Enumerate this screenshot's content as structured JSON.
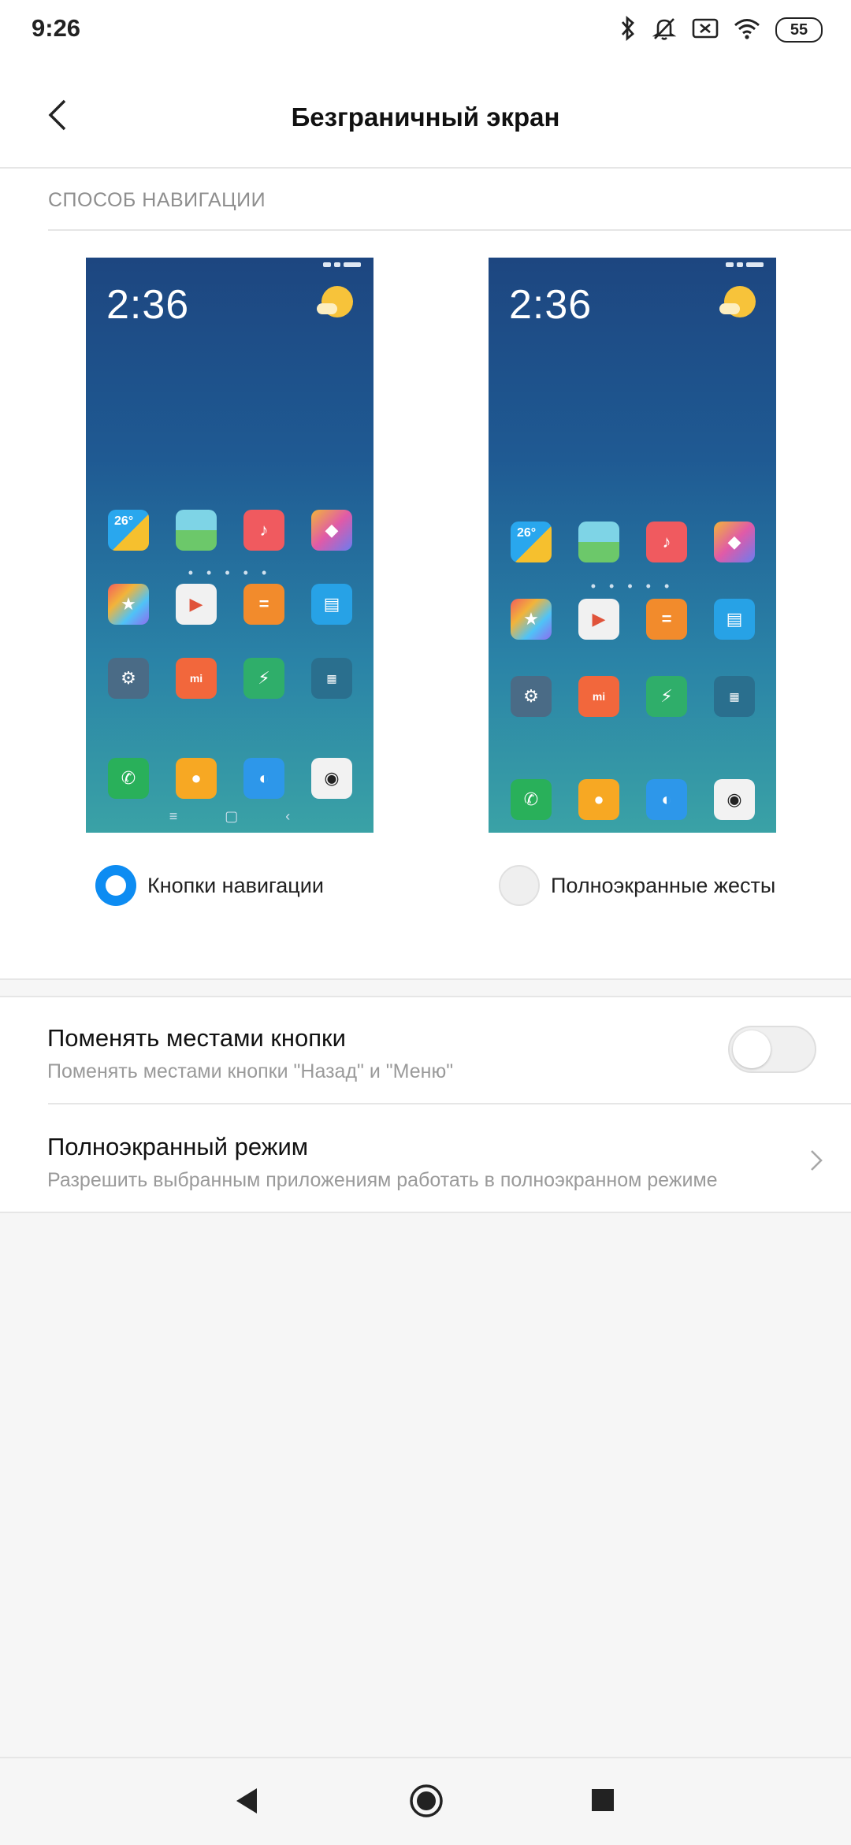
{
  "status_bar": {
    "time": "9:26",
    "battery": "55"
  },
  "header": {
    "title": "Безграничный экран"
  },
  "section": {
    "label": "СПОСОБ НАВИГАЦИИ"
  },
  "preview": {
    "clock": "2:36",
    "weather_tile": "26°",
    "store_tile": "mi"
  },
  "options": [
    {
      "label": "Кнопки навигации",
      "selected": true
    },
    {
      "label": "Полноэкранные жесты",
      "selected": false
    }
  ],
  "settings": {
    "swap": {
      "title": "Поменять местами кнопки",
      "subtitle": "Поменять местами кнопки \"Назад\" и \"Меню\"",
      "enabled": false
    },
    "fullscreen": {
      "title": "Полноэкранный режим",
      "subtitle": "Разрешить выбранным приложениям работать в полноэкранном режиме"
    }
  },
  "colors": {
    "accent": "#0d8cf2",
    "background": "#f6f6f6"
  }
}
